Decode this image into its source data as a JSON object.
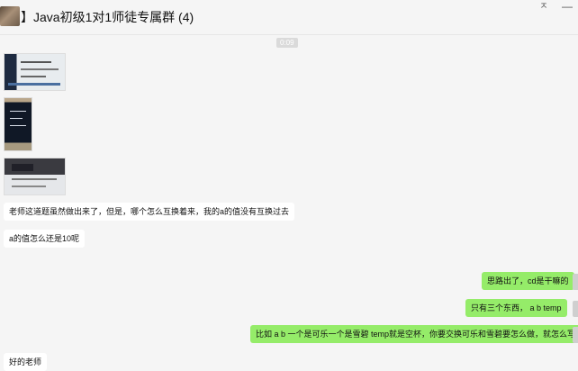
{
  "header": {
    "title": "】Java初级1对1师徒专属群 (4)",
    "pin_glyph": "ㅈ",
    "minimize_glyph": "—"
  },
  "time_divider": "0:09",
  "messages": [
    {
      "side": "left",
      "type": "image",
      "icon": "screenshot-image"
    },
    {
      "side": "left",
      "type": "image",
      "icon": "phone-photo-image"
    },
    {
      "side": "left",
      "type": "image",
      "icon": "screen-photo-image"
    },
    {
      "side": "left",
      "type": "text",
      "text": "老师这道题虽然做出来了，但是，哪个怎么互换着来，我的a的值没有互换过去"
    },
    {
      "side": "left",
      "type": "text",
      "text": "a的值怎么还是10呢"
    },
    {
      "side": "right",
      "type": "text",
      "text": "思路出了，cd是干嘛的"
    },
    {
      "side": "right",
      "type": "text",
      "text": "只有三个东西，  a b temp"
    },
    {
      "side": "right",
      "type": "text",
      "text": "比如  a b 一个是可乐一个是雪碧   temp就是空杯，你要交换可乐和雪碧要怎么做，就怎么写"
    },
    {
      "side": "left",
      "type": "text",
      "text": "好的老师"
    }
  ],
  "colors": {
    "background": "#f5f5f5",
    "outgoing_bubble": "#95ec69",
    "incoming_bubble": "#ffffff"
  }
}
